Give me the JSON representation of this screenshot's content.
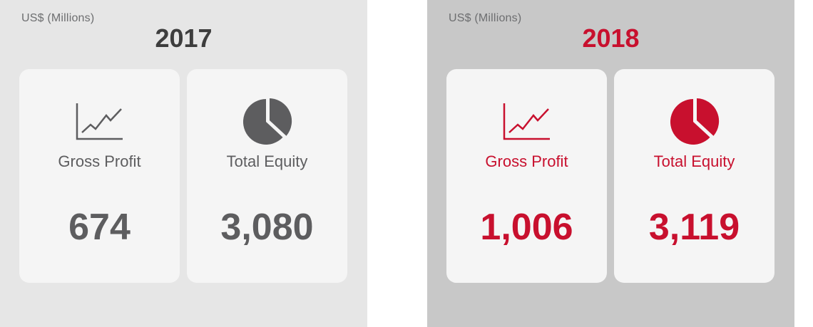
{
  "colors": {
    "muted_gray": "#5d5d5f",
    "brand_red": "#c8102e",
    "panel_2017_bg": "#e6e6e6",
    "panel_2018_bg": "#c8c8c8",
    "card_bg": "#f5f5f5"
  },
  "panels": [
    {
      "unit": "US$ (Millions)",
      "year": "2017",
      "cards": [
        {
          "icon": "line-chart-icon",
          "label": "Gross Profit",
          "value": "674"
        },
        {
          "icon": "pie-chart-icon",
          "label": "Total Equity",
          "value": "3,080"
        }
      ]
    },
    {
      "unit": "US$ (Millions)",
      "year": "2018",
      "cards": [
        {
          "icon": "line-chart-icon",
          "label": "Gross Profit",
          "value": "1,006"
        },
        {
          "icon": "pie-chart-icon",
          "label": "Total Equity",
          "value": "3,119"
        }
      ]
    }
  ]
}
